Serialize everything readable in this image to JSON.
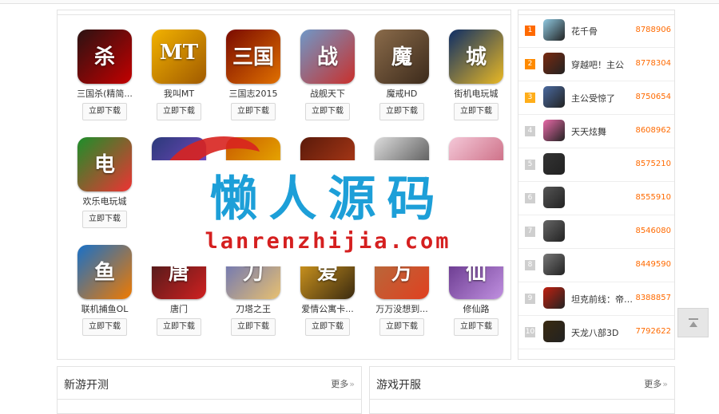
{
  "games": {
    "download_label": "立即下载",
    "rows": [
      [
        {
          "name": "三国杀(精简...",
          "icon": "sanguosha-icon",
          "color": "#2a1212",
          "accent": "#c40000",
          "glyph": "杀"
        },
        {
          "name": "我叫MT",
          "icon": "wojiaomt-icon",
          "color": "#f2b200",
          "accent": "#a05a00",
          "glyph": "MT"
        },
        {
          "name": "三国志2015",
          "icon": "sanguozhi-icon",
          "color": "#7a0a00",
          "accent": "#e07000",
          "glyph": "三国"
        },
        {
          "name": "战舰天下",
          "icon": "zhanjian-icon",
          "color": "#6f98c8",
          "accent": "#c9302c",
          "glyph": "战"
        },
        {
          "name": "魔戒HD",
          "icon": "mojie-icon",
          "color": "#8a6b4a",
          "accent": "#3c2a1b",
          "glyph": "魔"
        },
        {
          "name": "街机电玩城",
          "icon": "jieji-icon",
          "color": "#0e2e66",
          "accent": "#e9b824",
          "glyph": "城"
        }
      ],
      [
        {
          "name": "欢乐电玩城",
          "icon": "huanle-icon",
          "color": "#1c8f2a",
          "accent": "#e33",
          "glyph": "电"
        },
        {
          "name": "",
          "icon": "game-icon",
          "color": "#2a3a7a",
          "accent": "#8a4ad0",
          "glyph": ""
        },
        {
          "name": "",
          "icon": "game-icon",
          "color": "#c85a00",
          "accent": "#f0c000",
          "glyph": ""
        },
        {
          "name": "",
          "icon": "game-icon",
          "color": "#5a1a0a",
          "accent": "#c0401a",
          "glyph": ""
        },
        {
          "name": "",
          "icon": "game-icon",
          "color": "#dcdcdc",
          "accent": "#333",
          "glyph": ""
        },
        {
          "name": "",
          "icon": "game-icon",
          "color": "#f4c8d8",
          "accent": "#c0506a",
          "glyph": ""
        }
      ],
      [
        {
          "name": "联机捕鱼OL",
          "icon": "buyu-icon",
          "color": "#1870c8",
          "accent": "#f07a00",
          "glyph": "鱼"
        },
        {
          "name": "唐门",
          "icon": "tangmen-icon",
          "color": "#3a1a1a",
          "accent": "#d02020",
          "glyph": "唐"
        },
        {
          "name": "刀塔之王",
          "icon": "daota-icon",
          "color": "#5a6ac0",
          "accent": "#e8c070",
          "glyph": "刀"
        },
        {
          "name": "爱情公寓卡...",
          "icon": "aiqing-icon",
          "color": "#e8a820",
          "accent": "#3a2a10",
          "glyph": "爱"
        },
        {
          "name": "万万没想到...",
          "icon": "wanwan-icon",
          "color": "#b07040",
          "accent": "#e04020",
          "glyph": "万"
        },
        {
          "name": "修仙路",
          "icon": "xiuxian-icon",
          "color": "#5a2a80",
          "accent": "#c090e0",
          "glyph": "仙"
        }
      ]
    ]
  },
  "ranking": {
    "items": [
      {
        "rank": "1",
        "name": "花千骨",
        "value": "8788906",
        "color": "#8fc8e0"
      },
      {
        "rank": "2",
        "name": "穿越吧！主公",
        "value": "8778304",
        "color": "#7a2a10"
      },
      {
        "rank": "3",
        "name": "主公受惊了",
        "value": "8750654",
        "color": "#4a6aa0"
      },
      {
        "rank": "4",
        "name": "天天炫舞",
        "value": "8608962",
        "color": "#e86aa8"
      },
      {
        "rank": "5",
        "name": "",
        "value": "8575210",
        "color": "#333"
      },
      {
        "rank": "6",
        "name": "",
        "value": "8555910",
        "color": "#555"
      },
      {
        "rank": "7",
        "name": "",
        "value": "8546080",
        "color": "#666"
      },
      {
        "rank": "8",
        "name": "",
        "value": "8449590",
        "color": "#777"
      },
      {
        "rank": "9",
        "name": "坦克前线：帝国...",
        "value": "8388857",
        "color": "#c02010"
      },
      {
        "rank": "10",
        "name": "天龙八部3D",
        "value": "7792622",
        "color": "#3a2a10"
      }
    ]
  },
  "sections": {
    "new_test": {
      "title": "新游开测",
      "more": "更多"
    },
    "open_server": {
      "title": "游戏开服",
      "more": "更多"
    }
  },
  "watermark": {
    "title": "懒人源码",
    "url": "lanrenzhijia.com"
  },
  "colors": {
    "accent_orange": "#ff6a00",
    "watermark_blue": "#1d9fd8",
    "watermark_red": "#d51f1f"
  }
}
